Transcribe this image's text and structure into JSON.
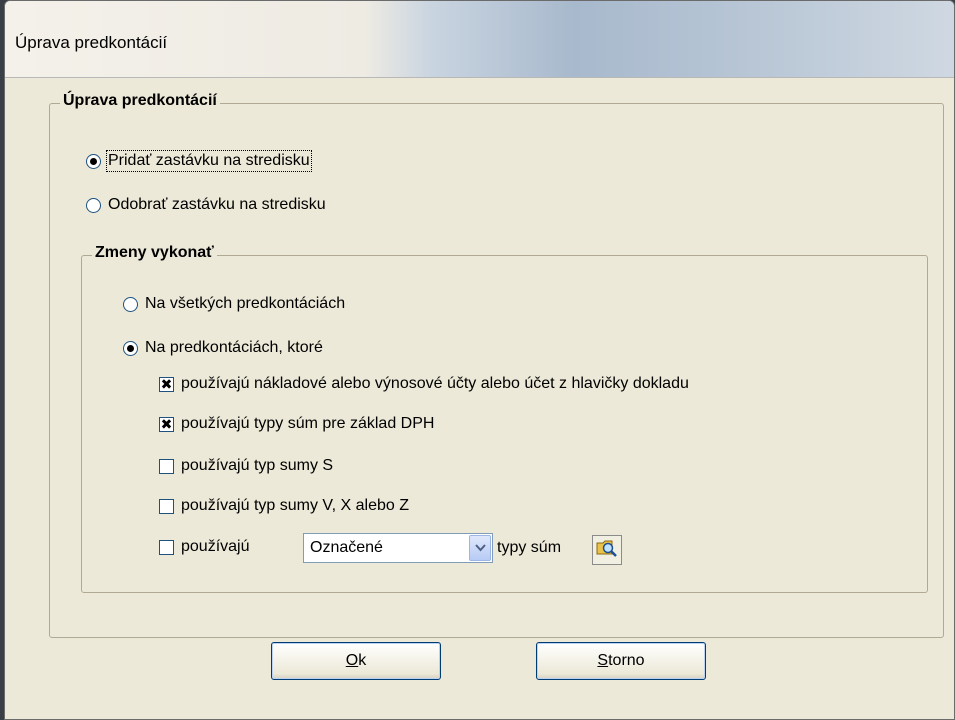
{
  "window": {
    "title": "Úprava predkontácií"
  },
  "group_main": {
    "legend": "Úprava predkontácií",
    "options": [
      {
        "label": "Pridať zastávku na stredisku",
        "checked": true
      },
      {
        "label": "Odobrať zastávku na stredisku",
        "checked": false
      }
    ]
  },
  "group_changes": {
    "legend": "Zmeny vykonať",
    "options": [
      {
        "label": "Na všetkých predkontáciách",
        "checked": false
      },
      {
        "label": "Na predkontáciách, ktoré",
        "checked": true
      }
    ],
    "checks": [
      {
        "label": "používajú nákladové alebo výnosové účty alebo účet z hlavičky dokladu",
        "checked": true,
        "mark": "✖"
      },
      {
        "label": "používajú typy súm pre základ DPH",
        "checked": true,
        "mark": "✖"
      },
      {
        "label": "používajú typ sumy S",
        "checked": false,
        "mark": ""
      },
      {
        "label": "používajú typ sumy V, X alebo Z",
        "checked": false,
        "mark": ""
      },
      {
        "label": "používajú",
        "checked": false,
        "mark": ""
      }
    ],
    "combo_value": "Označené",
    "combo_suffix": "typy súm"
  },
  "buttons": {
    "ok_hotkey": "O",
    "ok_rest": "k",
    "cancel_hotkey": "S",
    "cancel_rest": "torno"
  },
  "icons": {
    "combo_arrow": "chevron-down-icon",
    "lookup": "magnifier-folder-icon"
  },
  "colors": {
    "dialog_bg": "#ece9d8",
    "control_border": "#1c5180"
  }
}
